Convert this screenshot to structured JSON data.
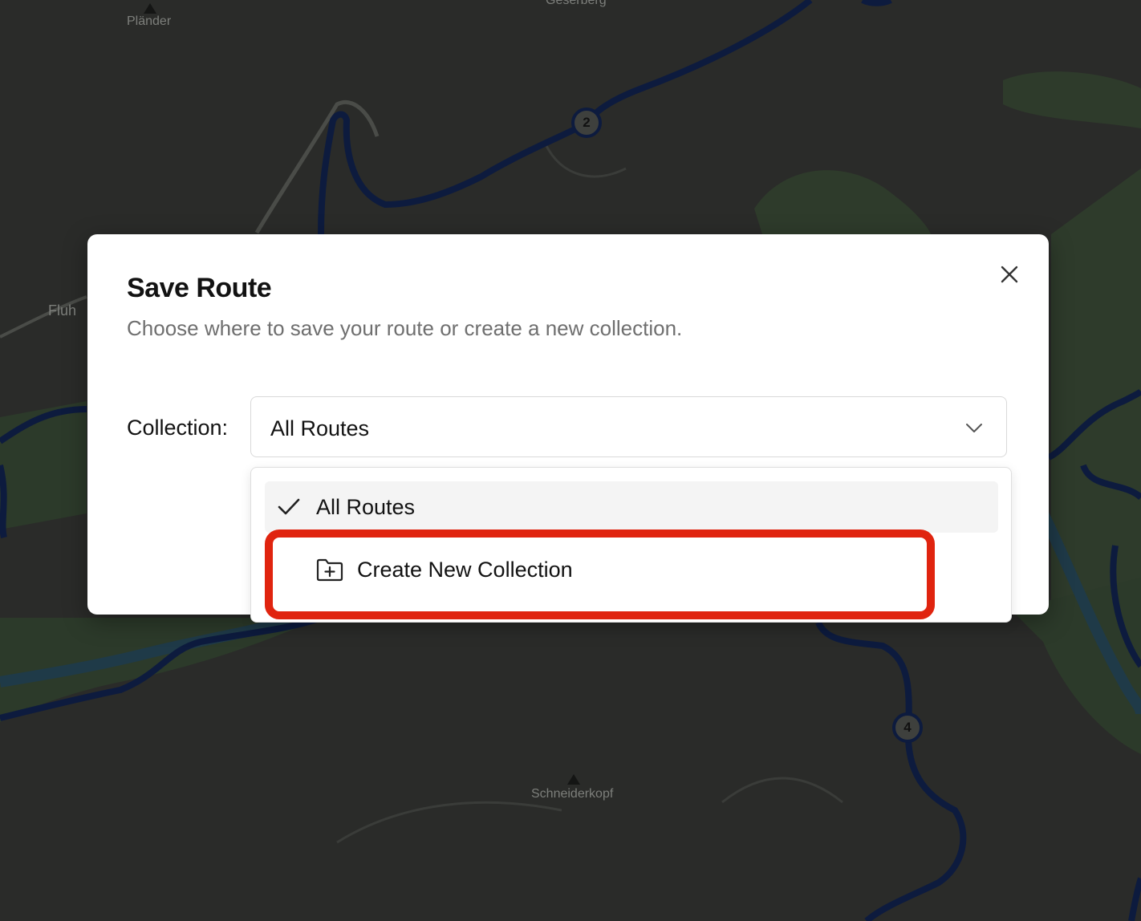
{
  "map": {
    "labels": {
      "plander": "Pländer",
      "geserberg": "Geserberg",
      "fluh": "Fluh",
      "schneiderkopf": "Schneiderkopf"
    },
    "route_shields": [
      "2",
      "4"
    ],
    "colors": {
      "background": "#2a2b29",
      "road": "#0d1b3e",
      "forest": "#2d3d2a"
    }
  },
  "modal": {
    "title": "Save Route",
    "description": "Choose where to save your route or create a new collection.",
    "close_icon": "close-icon",
    "collection_label": "Collection:",
    "select": {
      "value": "All Routes",
      "chevron_icon": "chevron-down-icon"
    }
  },
  "dropdown": {
    "options": [
      {
        "label": "All Routes",
        "icon": "check-icon"
      },
      {
        "label": "Create New Collection",
        "icon": "folder-plus-icon"
      }
    ]
  },
  "highlight_color": "#e0240f"
}
